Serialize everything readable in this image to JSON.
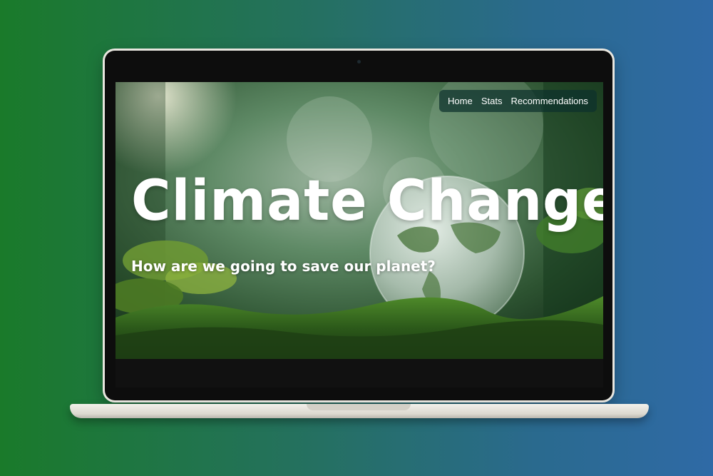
{
  "nav": {
    "items": [
      {
        "label": "Home"
      },
      {
        "label": "Stats"
      },
      {
        "label": "Recommendations"
      }
    ]
  },
  "hero": {
    "title": "Climate Change",
    "subtitle": "How are we going to save our planet?"
  },
  "colors": {
    "background_left": "#1a7a2a",
    "background_right": "#2f6aa6",
    "nav_background": "#0c302c",
    "text": "#ffffff"
  },
  "icons": {
    "hero_image": "glass-globe-in-moss"
  }
}
